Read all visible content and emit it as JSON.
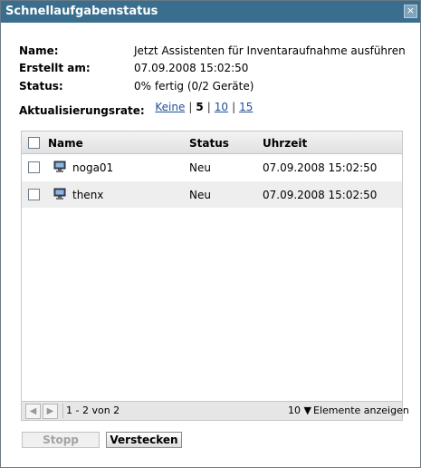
{
  "dialog": {
    "title": "Schnellaufgabenstatus",
    "close_symbol": "×"
  },
  "info": {
    "name_label": "Name:",
    "name_value": "Jetzt Assistenten für Inventaraufnahme ausführen",
    "created_label": "Erstellt am:",
    "created_value": "07.09.2008 15:02:50",
    "status_label": "Status:",
    "status_value": "0% fertig (0/2 Geräte)"
  },
  "refresh": {
    "label": "Aktualisierungsrate:",
    "options": [
      "Keine",
      "5",
      "10",
      "15"
    ],
    "selected": "5"
  },
  "table": {
    "columns": [
      "Name",
      "Status",
      "Uhrzeit"
    ],
    "rows": [
      {
        "name": "noga01",
        "status": "Neu",
        "time": "07.09.2008 15:02:50",
        "icon": "computer-icon"
      },
      {
        "name": "thenx",
        "status": "Neu",
        "time": "07.09.2008 15:02:50",
        "icon": "computer-icon"
      }
    ],
    "footer": {
      "range": "1 - 2 von 2",
      "page_size": "10",
      "page_size_label": "Elemente anzeigen"
    }
  },
  "buttons": {
    "stop": "Stopp",
    "hide": "Verstecken"
  },
  "colors": {
    "titlebar": "#3a6e8f",
    "link": "#1e4f9c",
    "row_alt": "#eeeeee"
  }
}
